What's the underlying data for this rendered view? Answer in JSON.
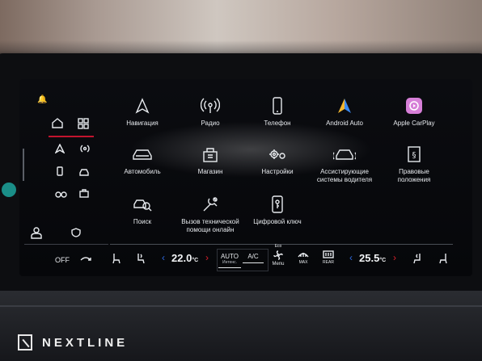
{
  "brand": {
    "name": "NEXTLINE"
  },
  "sidebar": {
    "icons": [
      "bell-icon",
      "home-icon",
      "grid-icon",
      "navigation-icon",
      "radio-icon",
      "phone-icon",
      "car-icon",
      "cars-icon",
      "store-icon",
      "user-icon",
      "shield-car-icon"
    ],
    "accent": "#c3142e"
  },
  "apps": [
    {
      "label": "Навигация",
      "icon": "navigation-icon"
    },
    {
      "label": "Радио",
      "icon": "radio-icon"
    },
    {
      "label": "Телефон",
      "icon": "phone-icon"
    },
    {
      "label": "Android Auto",
      "icon": "android-auto-icon"
    },
    {
      "label": "Apple CarPlay",
      "icon": "carplay-icon"
    },
    {
      "label": "Автомобиль",
      "icon": "car-icon"
    },
    {
      "label": "Магазин",
      "icon": "store-icon"
    },
    {
      "label": "Настройки",
      "icon": "gear-icon"
    },
    {
      "label": "Ассистирующие системы водителя",
      "line1": "Ассистирующие",
      "line2": "системы водителя",
      "icon": "assist-icon"
    },
    {
      "label": "Правовые положения",
      "line1": "Правовые",
      "line2": "положения",
      "icon": "legal-icon"
    },
    {
      "label": "Поиск",
      "icon": "search-icon"
    },
    {
      "label": "Вызов технической помощи онлайн",
      "line1": "Вызов технической",
      "line2": "помощи онлайн",
      "icon": "service-icon"
    },
    {
      "label": "Цифровой ключ",
      "icon": "digital-key-icon"
    }
  ],
  "climate": {
    "off_label": "OFF",
    "left_temp": "22.0",
    "left_temp_unit": "°C",
    "right_temp": "25.5",
    "right_temp_unit": "°C",
    "auto_label": "AUTO",
    "auto_sub": "Интенс.",
    "ac_label": "A/C",
    "eco_label": "Eco",
    "menu_label": "Menu",
    "max_label": "MAX",
    "rear_label": "REAR",
    "colors": {
      "cool": "#2f6ae0",
      "warm": "#d8202c"
    }
  }
}
